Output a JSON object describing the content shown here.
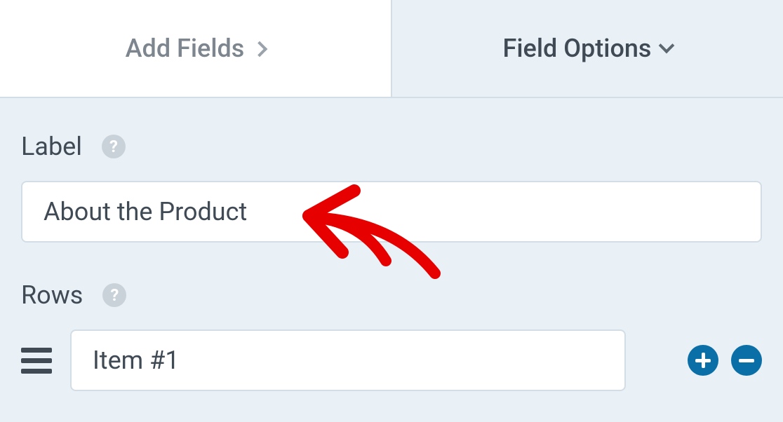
{
  "tabs": {
    "add_fields": "Add Fields",
    "field_options": "Field Options"
  },
  "label_section": {
    "title": "Label",
    "value": "About the Product"
  },
  "rows_section": {
    "title": "Rows",
    "items": [
      {
        "value": "Item #1"
      }
    ]
  }
}
